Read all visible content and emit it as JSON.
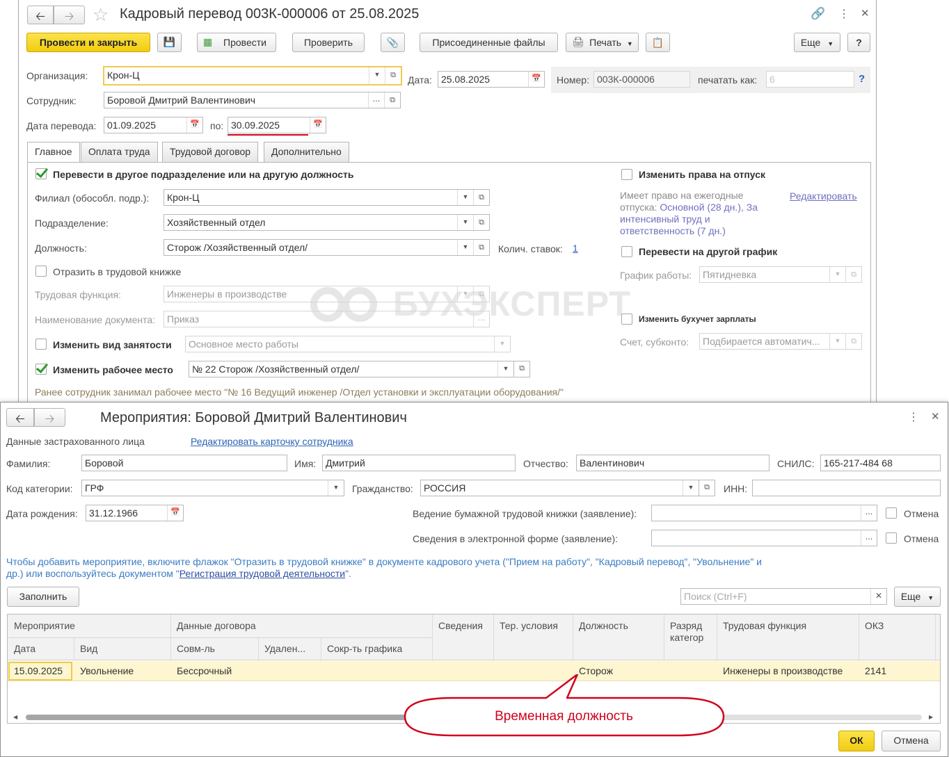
{
  "doc": {
    "title": "Кадровый перевод 003К-000006 от 25.08.2025",
    "toolbar": {
      "post_close": "Провести и закрыть",
      "post": "Провести",
      "check": "Проверить",
      "files": "Присоединенные файлы",
      "print": "Печать",
      "more": "Еще",
      "help": "?"
    },
    "org_label": "Организация:",
    "org_value": "Крон-Ц",
    "date_label": "Дата:",
    "date_value": "25.08.2025",
    "number_label": "Номер:",
    "number_value": "003К-000006",
    "print_as_label": "печатать как:",
    "print_as_value": "6",
    "help_q": "?",
    "employee_label": "Сотрудник:",
    "employee_value": "Боровой Дмитрий Валентинович",
    "transfer_date_label": "Дата перевода:",
    "transfer_date_value": "01.09.2025",
    "to_label": "по:",
    "to_value": "30.09.2025",
    "tabs": [
      "Главное",
      "Оплата труда",
      "Трудовой договор",
      "Дополнительно"
    ],
    "main": {
      "transfer_check": "Перевести в другое подразделение или на другую должность",
      "branch_label": "Филиал (обособл. подр.):",
      "branch_value": "Крон-Ц",
      "dept_label": "Подразделение:",
      "dept_value": "Хозяйственный отдел",
      "position_label": "Должность:",
      "position_value": "Сторож /Хозяйственный отдел/",
      "rate_label": "Колич. ставок:",
      "rate_value": "1",
      "book_check": "Отразить в трудовой книжке",
      "func_label": "Трудовая функция:",
      "func_value": "Инженеры в производстве",
      "docname_label": "Наименование документа:",
      "docname_value": "Приказ",
      "employment_check": "Изменить вид занятости",
      "employment_value": "Основное место работы",
      "workplace_check": "Изменить рабочее место",
      "workplace_value": "№ 22 Сторож /Хозяйственный отдел/",
      "previous_text": "Ранее сотрудник занимал рабочее место \"№ 16 Ведущий инженер /Отдел установки и эксплуатации оборудования/\"",
      "vacation_check": "Изменить права на отпуск",
      "vacation_text1": "Имеет право на ежегодные",
      "vacation_text2": "отпуска:",
      "vacation_note1": "Основной (28 дн.), За",
      "vacation_note2": "интенсивный труд и",
      "vacation_note3": "ответственность (7 дн.)",
      "edit_link": "Редактировать",
      "schedule_check": "Перевести на другой график",
      "schedule_label": "График работы:",
      "schedule_value": "Пятидневка",
      "accounting_check": "Изменить бухучет зарплаты",
      "account_label": "Счет, субконто:",
      "account_value": "Подбирается автоматич..."
    },
    "watermark": "БУХЭКСПЕРТ"
  },
  "dialog": {
    "title": "Мероприятия: Боровой Дмитрий Валентинович",
    "insured_label": "Данные застрахованного лица",
    "edit_card_link": "Редактировать карточку сотрудника",
    "surname_label": "Фамилия:",
    "surname_value": "Боровой",
    "name_label": "Имя:",
    "name_value": "Дмитрий",
    "patronymic_label": "Отчество:",
    "patronymic_value": "Валентинович",
    "snils_label": "СНИЛС:",
    "snils_value": "165-217-484 68",
    "category_label": "Код категории:",
    "category_value": "ГРФ",
    "citizenship_label": "Гражданство:",
    "citizenship_value": "РОССИЯ",
    "inn_label": "ИНН:",
    "inn_value": "",
    "birth_label": "Дата рождения:",
    "birth_value": "31.12.1966",
    "paper_book_label": "Ведение бумажной трудовой книжки (заявление):",
    "electronic_label": "Сведения в электронной форме (заявление):",
    "cancel_label": "Отмена",
    "info_text1": "Чтобы добавить мероприятие, включите флажок \"Отразить в трудовой книжке\" в документе кадрового учета (\"Прием на работу\", \"Кадровый перевод\", \"Увольнение\" и",
    "info_text2a": "др.) или воспользуйтесь документом \"",
    "info_link": "Регистрация трудовой деятельности",
    "info_text2b": "\".",
    "fill_button": "Заполнить",
    "search_placeholder": "Поиск (Ctrl+F)",
    "more_button": "Еще",
    "table": {
      "group_event": "Мероприятие",
      "group_contract": "Данные договора",
      "col_info": "Сведения",
      "col_terr": "Тер. условия",
      "col_position": "Должность",
      "col_rank1": "Разряд",
      "col_rank2": "категор",
      "col_function": "Трудовая функция",
      "col_okz": "ОКЗ",
      "sub_date": "Дата",
      "sub_kind": "Вид",
      "sub_combo": "Совм-ль",
      "sub_remote": "Удален...",
      "sub_short": "Сокр-ть графика",
      "rows": [
        {
          "date": "15.09.2025",
          "kind": "Увольнение",
          "combo": "Бессрочный",
          "remote": "",
          "short": "",
          "info": "",
          "terr": "",
          "position": "Сторож",
          "rank": "",
          "function": "Инженеры в производстве",
          "okz": "2141"
        }
      ]
    },
    "ok_button": "ОК",
    "cancel_button": "Отмена"
  },
  "callout": {
    "text": "Временная должность",
    "color": "#d0021b"
  },
  "colors": {
    "accent_yellow": "#f5d327",
    "link_blue": "#2b63b8",
    "info_blue": "#3a7cc4",
    "row_highlight": "#fdf6d0"
  }
}
